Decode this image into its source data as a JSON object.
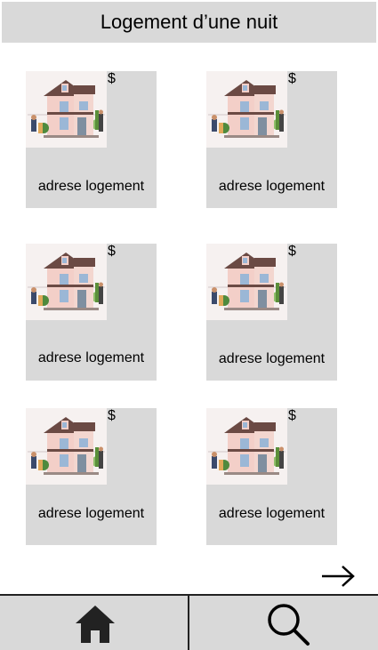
{
  "header": {
    "title": "Logement d’une nuit"
  },
  "listings": [
    {
      "price": "$",
      "address": "adrese logement"
    },
    {
      "price": "$",
      "address": "adrese logement"
    },
    {
      "price": "$",
      "address": "adrese logement"
    },
    {
      "price": "$",
      "address": "adrese logement"
    },
    {
      "price": "$",
      "address": "adrese logement"
    },
    {
      "price": "$",
      "address": "adrese logement"
    }
  ],
  "icons": {
    "next": "arrow-right-icon",
    "home": "home-icon",
    "search": "search-icon"
  },
  "colors": {
    "header_bg": "#d9d9d9",
    "card_bg": "#d9d9d9",
    "nav_bg": "#d9d9d9"
  }
}
